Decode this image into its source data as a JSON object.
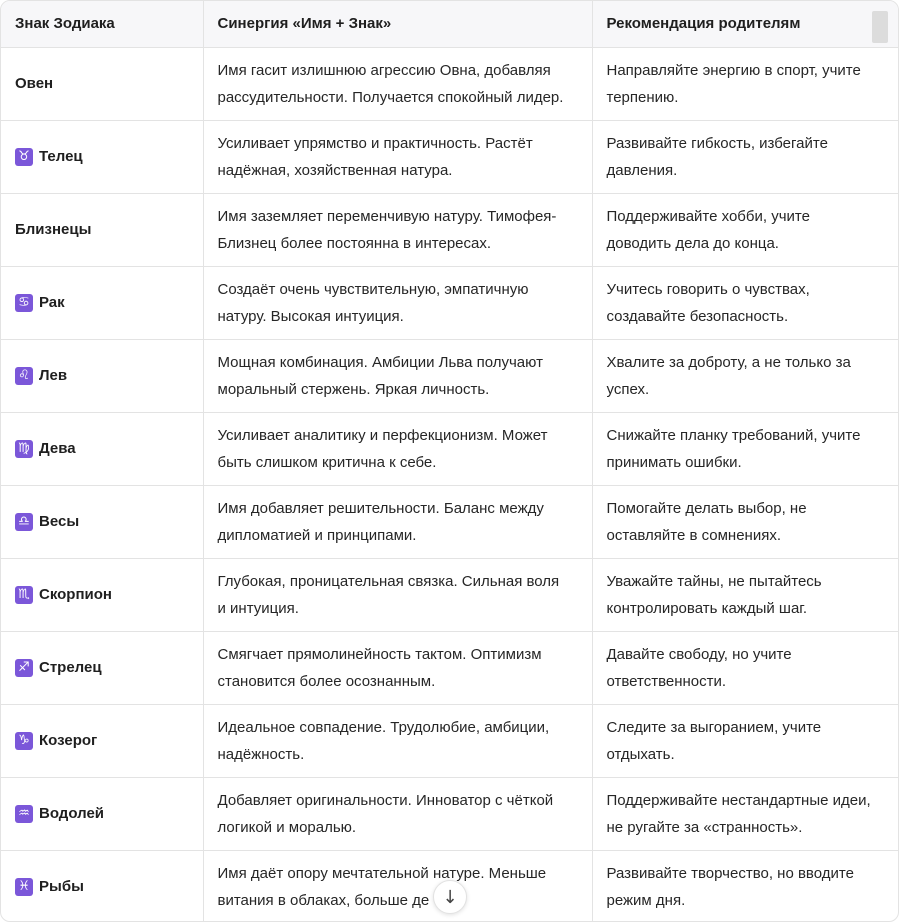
{
  "table": {
    "headers": [
      "Знак Зодиака",
      "Синергия «Имя + Знак»",
      "Рекомендация родителям"
    ],
    "rows": [
      {
        "icon": "",
        "icon_name": "",
        "sign": "Овен",
        "synergy": [
          "Имя гасит излишнюю агрессию Овна, добавляя",
          "рассудительности. Получается спокойный лидер."
        ],
        "advice": [
          "Направляйте энергию в спорт, учите",
          "терпению."
        ]
      },
      {
        "icon": "♉",
        "icon_name": "taurus-icon",
        "sign": "Телец",
        "synergy": [
          "Усиливает упрямство и практичность. Растёт",
          "надёжная, хозяйственная натура."
        ],
        "advice": [
          "Развивайте гибкость, избегайте",
          "давления."
        ]
      },
      {
        "icon": "",
        "icon_name": "",
        "sign": "Близнецы",
        "synergy": [
          "Имя заземляет переменчивую натуру. Тимофея-",
          "Близнец более постоянна в интересах."
        ],
        "advice": [
          "Поддерживайте хобби, учите",
          "доводить дела до конца."
        ]
      },
      {
        "icon": "♋",
        "icon_name": "cancer-icon",
        "sign": "Рак",
        "synergy": [
          "Создаёт очень чувствительную, эмпатичную",
          "натуру. Высокая интуиция."
        ],
        "advice": [
          "Учитесь говорить о чувствах,",
          "создавайте безопасность."
        ]
      },
      {
        "icon": "♌",
        "icon_name": "leo-icon",
        "sign": "Лев",
        "synergy": [
          "Мощная комбинация. Амбиции Льва получают",
          "моральный стержень. Яркая личность."
        ],
        "advice": [
          "Хвалите за доброту, а не только за",
          "успех."
        ]
      },
      {
        "icon": "♍",
        "icon_name": "virgo-icon",
        "sign": "Дева",
        "synergy": [
          "Усиливает аналитику и перфекционизм. Может",
          "быть слишком критична к себе."
        ],
        "advice": [
          "Снижайте планку требований, учите",
          "принимать ошибки."
        ]
      },
      {
        "icon": "♎",
        "icon_name": "libra-icon",
        "sign": "Весы",
        "synergy": [
          "Имя добавляет решительности. Баланс между",
          "дипломатией и принципами."
        ],
        "advice": [
          "Помогайте делать выбор, не",
          "оставляйте в сомнениях."
        ]
      },
      {
        "icon": "♏",
        "icon_name": "scorpio-icon",
        "sign": "Скорпион",
        "synergy": [
          "Глубокая, проницательная связка. Сильная воля",
          "и интуиция."
        ],
        "advice": [
          "Уважайте тайны, не пытайтесь",
          "контролировать каждый шаг."
        ]
      },
      {
        "icon": "♐",
        "icon_name": "sagittarius-icon",
        "sign": "Стрелец",
        "synergy": [
          "Смягчает прямолинейность тактом. Оптимизм",
          "становится более осознанным."
        ],
        "advice": [
          "Давайте свободу, но учите",
          "ответственности."
        ]
      },
      {
        "icon": "♑",
        "icon_name": "capricorn-icon",
        "sign": "Козерог",
        "synergy": [
          "Идеальное совпадение. Трудолюбие, амбиции,",
          "надёжность."
        ],
        "advice": [
          "Следите за выгоранием, учите",
          "отдыхать."
        ]
      },
      {
        "icon": "♒",
        "icon_name": "aquarius-icon",
        "sign": "Водолей",
        "synergy": [
          "Добавляет оригинальности. Инноватор с чёткой",
          "логикой и моралью."
        ],
        "advice": [
          "Поддерживайте нестандартные идеи,",
          "не ругайте за «странность»."
        ]
      },
      {
        "icon": "♓",
        "icon_name": "pisces-icon",
        "sign": "Рыбы",
        "synergy": [
          "Имя даёт опору мечтательной натуре. Меньше",
          "витания в облаках, больше де"
        ],
        "advice": [
          "Развивайте творчество, но вводите",
          "режим дня."
        ]
      }
    ]
  },
  "scroll_button": {
    "icon": "↓",
    "icon_name": "arrow-down-icon"
  },
  "colors": {
    "icon_bg": "#7b57d9",
    "header_bg": "#f7f7f9",
    "border": "#e3e3e3"
  }
}
